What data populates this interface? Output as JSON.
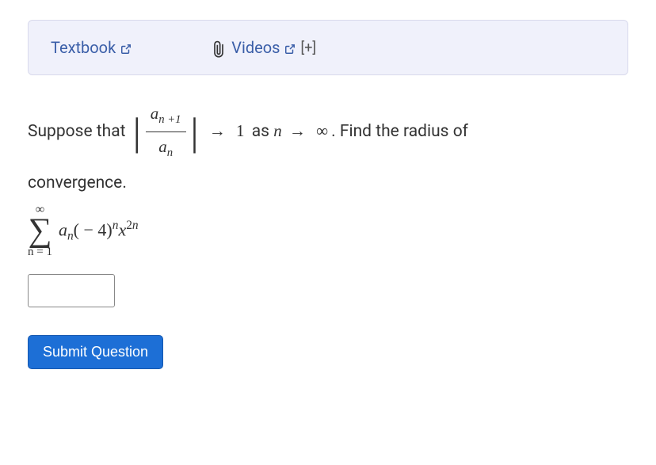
{
  "resources": {
    "textbook_label": "Textbook",
    "videos_label": "Videos",
    "plus_badge": "[+]"
  },
  "problem": {
    "intro": "Suppose that ",
    "frac_num": "a",
    "frac_num_sub": "n +1",
    "frac_den": "a",
    "frac_den_sub": "n",
    "arrow": "→",
    "limit_value": "1",
    "as_text": " as ",
    "n_var": "n",
    "arrow2": "→",
    "infinity": "∞",
    "find_text": ". Find the radius of",
    "convergence_text": "convergence."
  },
  "series": {
    "sigma_top": "∞",
    "sigma": "∑",
    "sigma_bottom": "n = 1",
    "term_a": "a",
    "term_a_sub": "n",
    "paren_open": "(",
    "minus": " − ",
    "four": "4",
    "paren_close": ")",
    "exp_n": "n",
    "x_var": "x",
    "exp_2n": "2n"
  },
  "answer": {
    "value": ""
  },
  "submit_label": "Submit Question"
}
